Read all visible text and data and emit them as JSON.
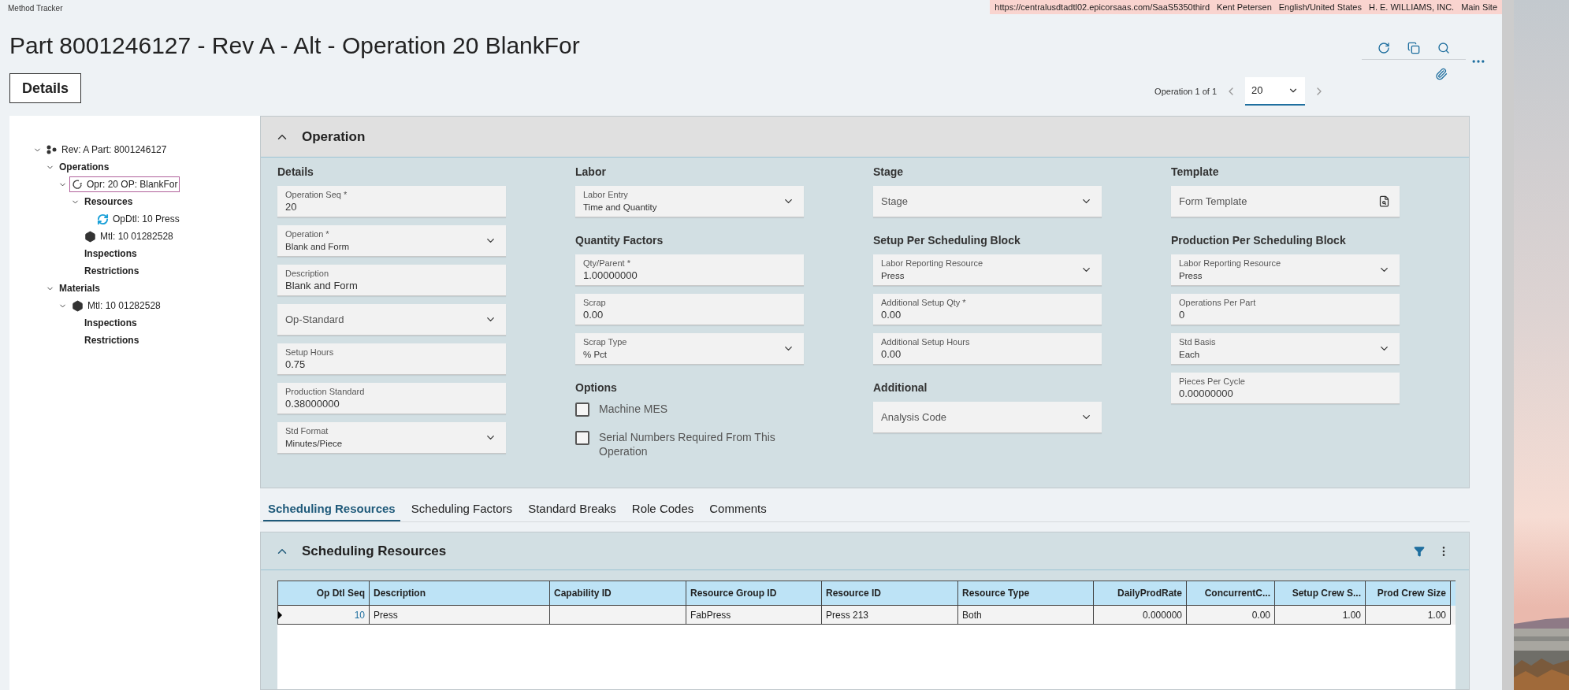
{
  "app_title": "Method Tracker",
  "session": [
    "https://centralusdtadtl02.epicorsaas.com/SaaS5350third",
    "Kent Petersen",
    "English/United States",
    "H. E. WILLIAMS, INC.",
    "Main Site"
  ],
  "page_title": "Part 8001246127 - Rev A - Alt - Operation 20 BlankFor",
  "details_button": "Details",
  "navigator": {
    "label": "Operation 1 of 1",
    "value": "20"
  },
  "tree": [
    {
      "label": "Rev: A Part: 8001246127",
      "kind": "part",
      "expanded": true,
      "selected": false,
      "children": [
        {
          "label": "Operations",
          "kind": "folder",
          "expanded": true,
          "selected": false,
          "children": [
            {
              "label": "Opr: 20 OP: BlankFor",
              "kind": "operation",
              "expanded": true,
              "selected": true,
              "children": [
                {
                  "label": "Resources",
                  "kind": "folder",
                  "expanded": true,
                  "selected": false,
                  "children": [
                    {
                      "label": "OpDtl: 10 Press",
                      "kind": "resource",
                      "selected": false
                    }
                  ]
                },
                {
                  "label": "Mtl: 10 01282528",
                  "kind": "material",
                  "selected": false
                },
                {
                  "label": "Inspections",
                  "kind": "folder",
                  "selected": false
                },
                {
                  "label": "Restrictions",
                  "kind": "folder",
                  "selected": false
                }
              ]
            }
          ]
        },
        {
          "label": "Materials",
          "kind": "folder",
          "expanded": true,
          "selected": false,
          "children": [
            {
              "label": "Mtl: 10 01282528",
              "kind": "material",
              "expanded": true,
              "selected": false,
              "children": [
                {
                  "label": "Inspections",
                  "kind": "folder",
                  "selected": false
                },
                {
                  "label": "Restrictions",
                  "kind": "folder",
                  "selected": false
                }
              ]
            }
          ]
        }
      ]
    }
  ],
  "operation_panel": {
    "title": "Operation",
    "expanded": true,
    "columns": [
      [
        {
          "heading": "Details",
          "fields": [
            {
              "kind": "text",
              "label": "Operation Seq *",
              "value": "20"
            },
            {
              "kind": "select",
              "label": "Operation *",
              "value": "Blank and Form"
            },
            {
              "kind": "text",
              "label": "Description",
              "value": "Blank and Form"
            },
            {
              "kind": "select",
              "placeholder": "Op-Standard"
            },
            {
              "kind": "text",
              "label": "Setup Hours",
              "value": "0.75"
            },
            {
              "kind": "text",
              "label": "Production Standard",
              "value": "0.38000000"
            },
            {
              "kind": "select",
              "label": "Std Format",
              "value": "Minutes/Piece"
            }
          ]
        }
      ],
      [
        {
          "heading": "Labor",
          "fields": [
            {
              "kind": "select",
              "label": "Labor Entry",
              "value": "Time and Quantity"
            }
          ]
        },
        {
          "heading": "Quantity Factors",
          "fields": [
            {
              "kind": "text",
              "label": "Qty/Parent *",
              "value": "1.00000000"
            },
            {
              "kind": "text",
              "label": "Scrap",
              "value": "0.00"
            },
            {
              "kind": "select",
              "label": "Scrap Type",
              "value": "% Pct"
            }
          ]
        },
        {
          "heading": "Options",
          "fields": [
            {
              "kind": "checkbox",
              "label": "Machine MES",
              "checked": false
            },
            {
              "kind": "checkbox",
              "label": "Serial Numbers Required From This Operation",
              "checked": false
            }
          ]
        }
      ],
      [
        {
          "heading": "Stage",
          "fields": [
            {
              "kind": "select",
              "placeholder": "Stage"
            }
          ]
        },
        {
          "heading": "Setup Per Scheduling Block",
          "fields": [
            {
              "kind": "select",
              "label": "Labor Reporting Resource",
              "value": "Press"
            },
            {
              "kind": "text",
              "label": "Additional Setup Qty *",
              "value": "0.00"
            },
            {
              "kind": "text",
              "label": "Additional Setup Hours",
              "value": "0.00"
            }
          ]
        },
        {
          "heading": "Additional",
          "fields": [
            {
              "kind": "select",
              "placeholder": "Analysis Code"
            }
          ]
        }
      ],
      [
        {
          "heading": "Template",
          "fields": [
            {
              "kind": "lookup",
              "placeholder": "Form Template"
            }
          ]
        },
        {
          "heading": "Production Per Scheduling Block",
          "fields": [
            {
              "kind": "select",
              "label": "Labor Reporting Resource",
              "value": "Press"
            },
            {
              "kind": "text",
              "label": "Operations Per Part",
              "value": "0"
            },
            {
              "kind": "select",
              "label": "Std Basis",
              "value": "Each"
            },
            {
              "kind": "text",
              "label": "Pieces Per Cycle",
              "value": "0.00000000"
            }
          ]
        }
      ]
    ]
  },
  "tabs": [
    {
      "label": "Scheduling Resources",
      "selected": true
    },
    {
      "label": "Scheduling Factors",
      "selected": false
    },
    {
      "label": "Standard Breaks",
      "selected": false
    },
    {
      "label": "Role Codes",
      "selected": false
    },
    {
      "label": "Comments",
      "selected": false
    }
  ],
  "grid_panel": {
    "title": "Scheduling Resources",
    "expanded": true,
    "columns": [
      {
        "label": "Op Dtl Seq",
        "numeric": true
      },
      {
        "label": "Description",
        "numeric": false
      },
      {
        "label": "Capability ID",
        "numeric": false
      },
      {
        "label": "Resource Group ID",
        "numeric": false
      },
      {
        "label": "Resource ID",
        "numeric": false
      },
      {
        "label": "Resource Type",
        "numeric": false
      },
      {
        "label": "DailyProdRate",
        "numeric": true
      },
      {
        "label": "ConcurrentC...",
        "numeric": true
      },
      {
        "label": "Setup Crew S...",
        "numeric": true
      },
      {
        "label": "Prod Crew Size",
        "numeric": true
      }
    ],
    "rows": [
      {
        "selected": true,
        "cells": [
          "10",
          "Press",
          "",
          "FabPress",
          "Press 213",
          "Both",
          "0.000000",
          "0.00",
          "1.00",
          "1.00"
        ]
      }
    ]
  }
}
